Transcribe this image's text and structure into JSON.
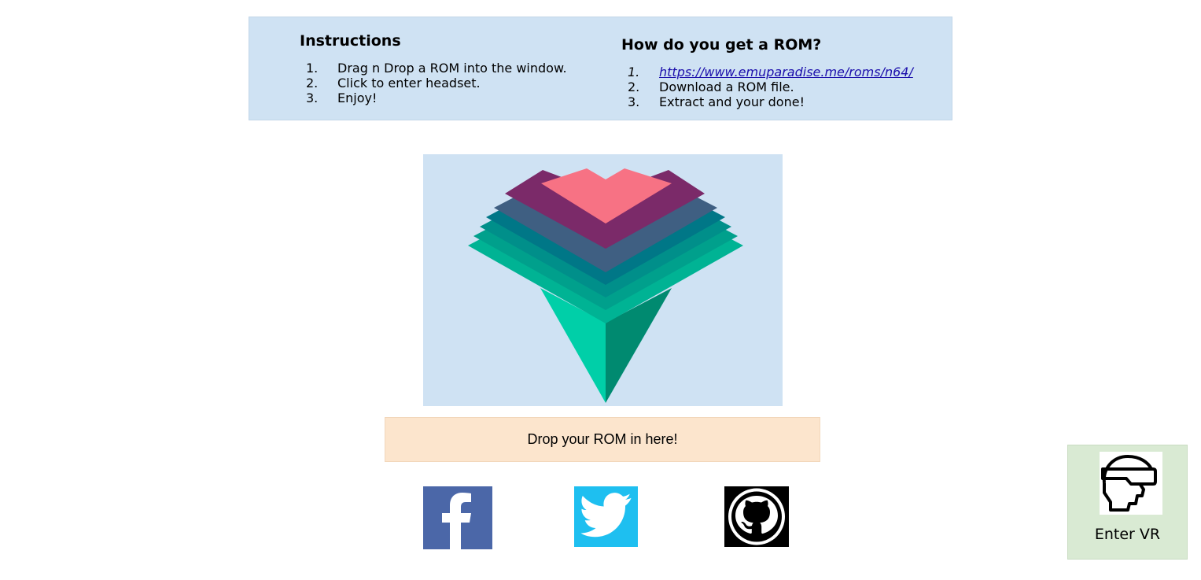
{
  "instructions": {
    "title": "Instructions",
    "steps": [
      {
        "num": "1.",
        "text": "Drag n Drop a ROM into the window."
      },
      {
        "num": "2.",
        "text": "Click to enter headset."
      },
      {
        "num": "3.",
        "text": "Enjoy!"
      }
    ]
  },
  "rom_help": {
    "title": "How do you get a ROM?",
    "steps": [
      {
        "num": "1.",
        "text": "https://www.emuparadise.me/roms/n64/",
        "is_link": true
      },
      {
        "num": "2.",
        "text": "Download a ROM file."
      },
      {
        "num": "3.",
        "text": "Extract and your done!"
      }
    ]
  },
  "logo": {
    "icon": "layered-diamond-logo"
  },
  "drop_zone": {
    "label": "Drop your ROM in here!"
  },
  "social": [
    {
      "icon": "facebook-icon",
      "color": "#4b67a8"
    },
    {
      "icon": "twitter-icon",
      "color": "#1ebff0"
    },
    {
      "icon": "github-icon",
      "color": "#000000"
    }
  ],
  "enter_vr": {
    "label": "Enter VR",
    "icon": "vr-headset-icon"
  },
  "colors": {
    "panel_blue": "#cfe2f3",
    "drop_peach": "#fce5cd",
    "vr_green": "#d9ead3",
    "link": "#1a0dab"
  }
}
